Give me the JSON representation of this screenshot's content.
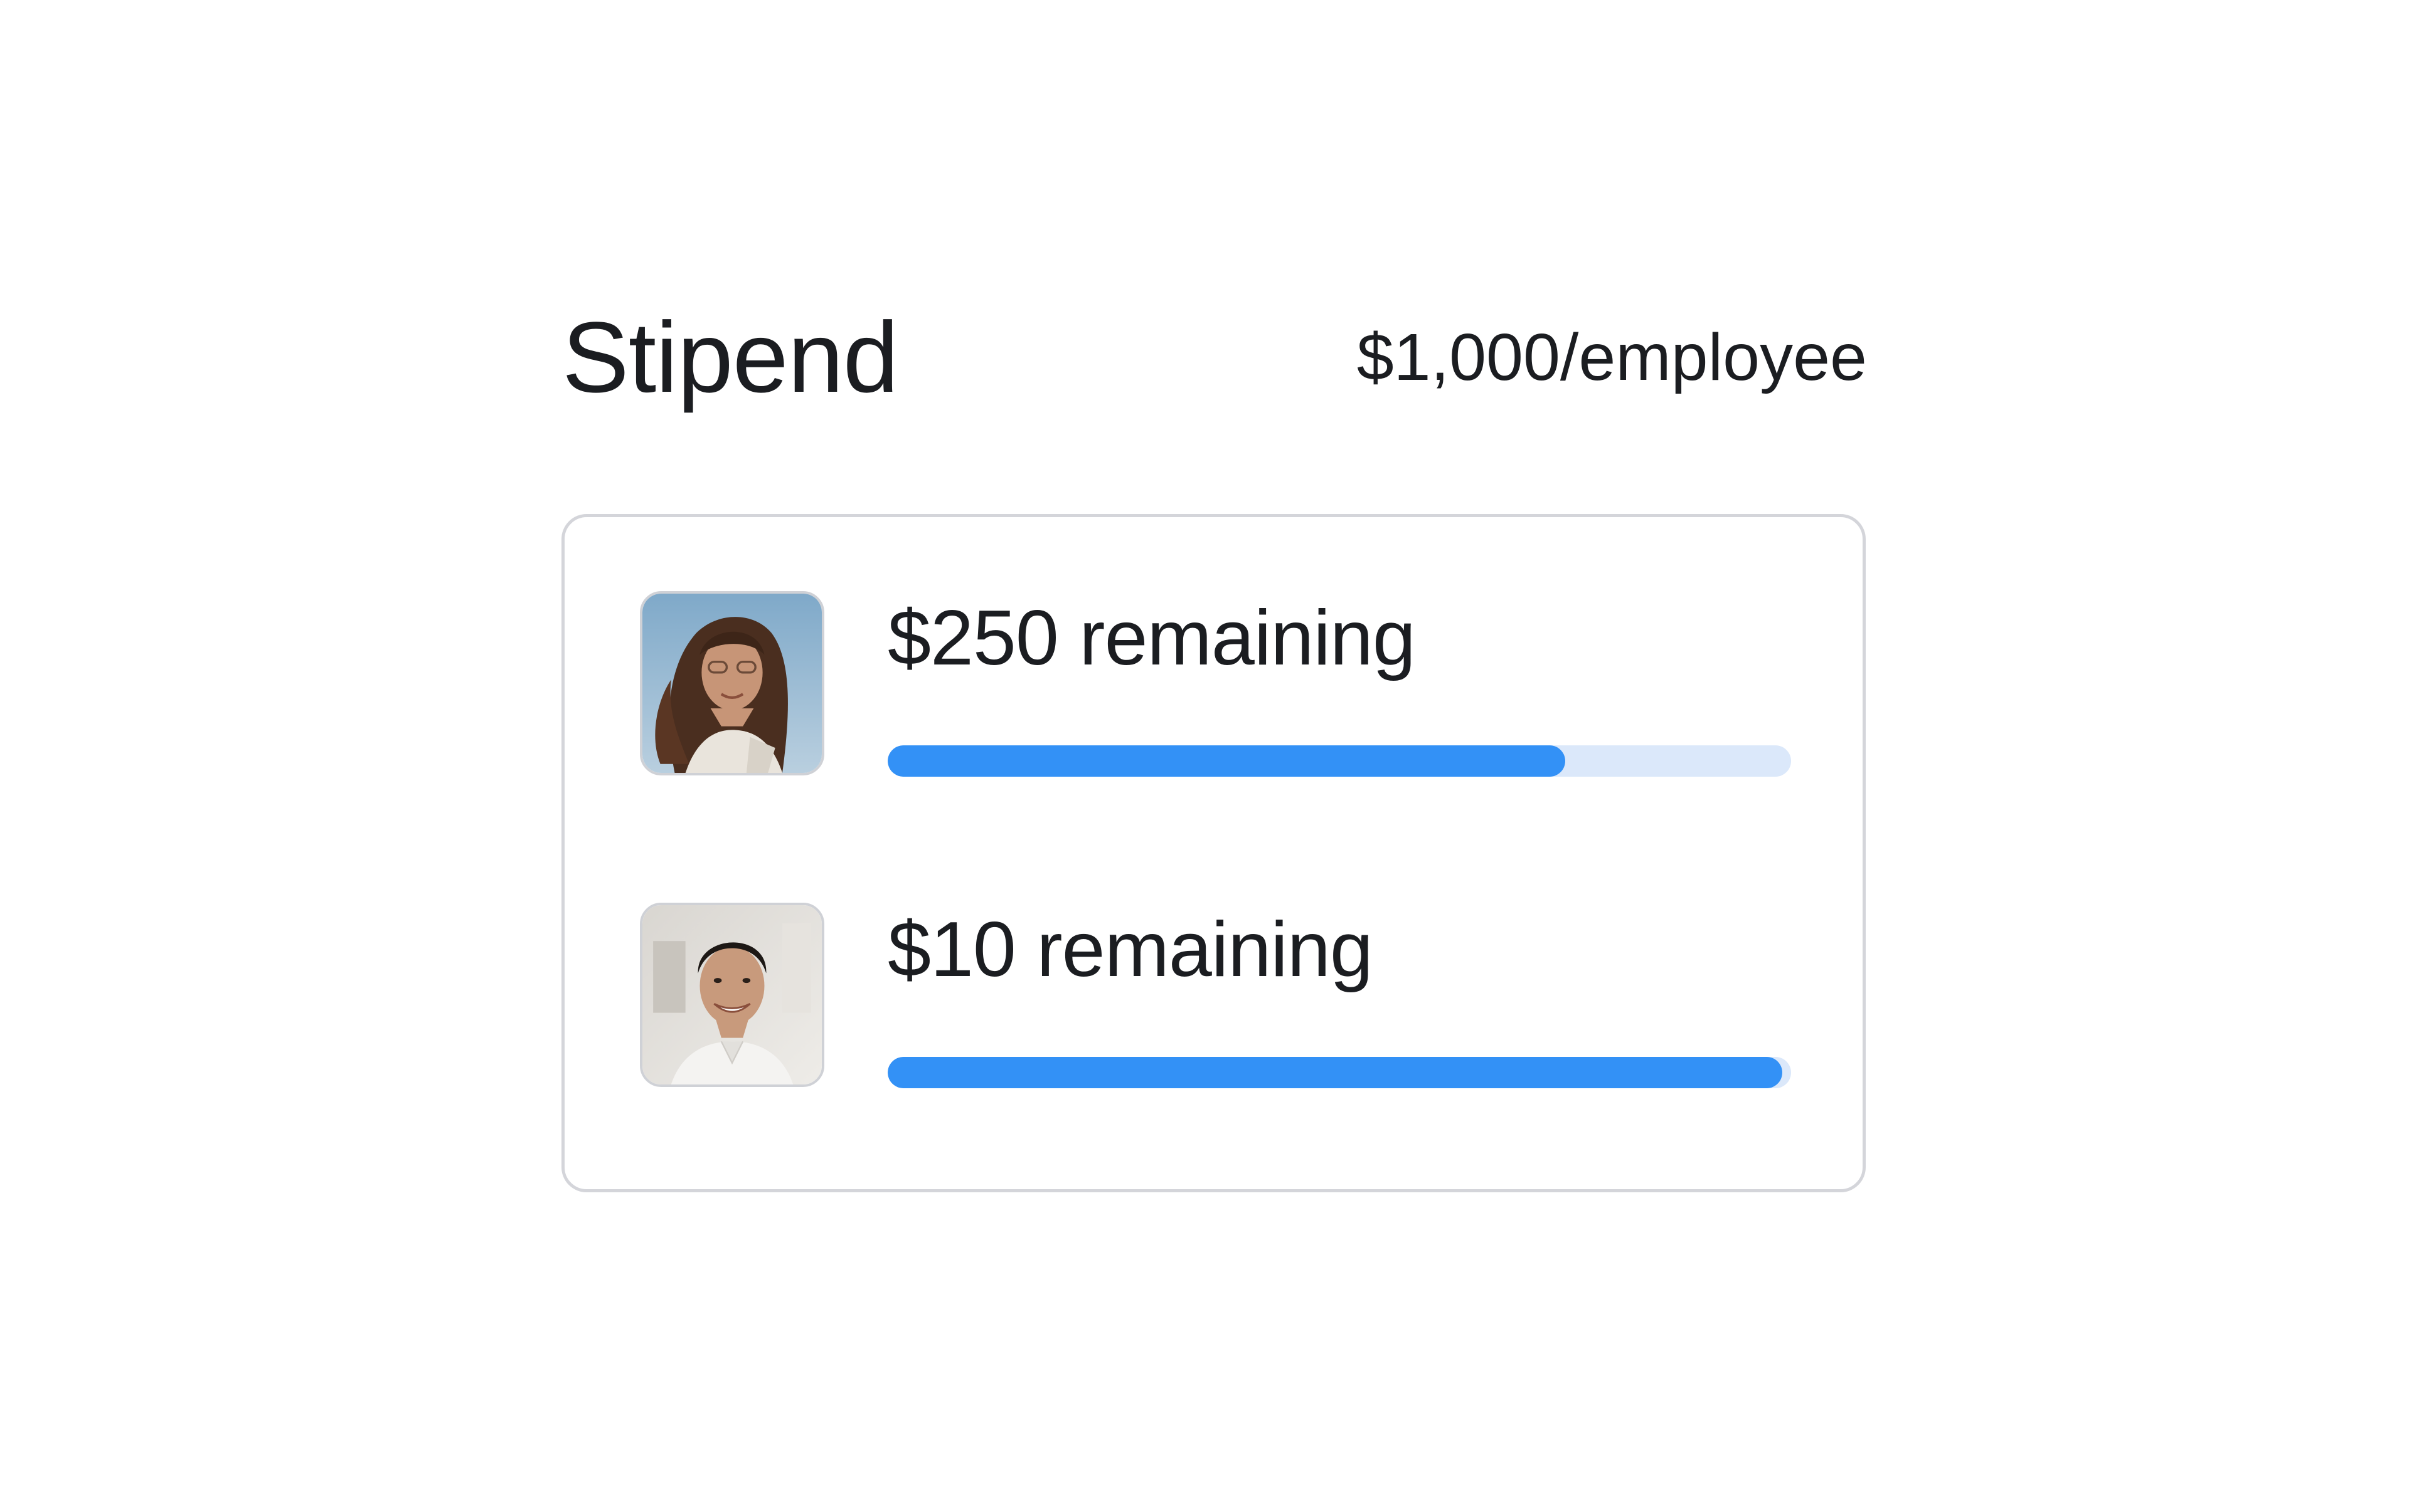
{
  "stipend": {
    "title": "Stipend",
    "rate": "$1,000/employee"
  },
  "employees": [
    {
      "remaining_label": "$250 remaining",
      "progress": 0.75,
      "avatar": "woman-portrait-photo"
    },
    {
      "remaining_label": "$10 remaining",
      "progress": 0.99,
      "avatar": "man-portrait-photo"
    }
  ],
  "colors": {
    "accent": "#3391f6",
    "track": "#dbe8fa",
    "border": "#d4d5da",
    "text": "#1b1d21"
  }
}
